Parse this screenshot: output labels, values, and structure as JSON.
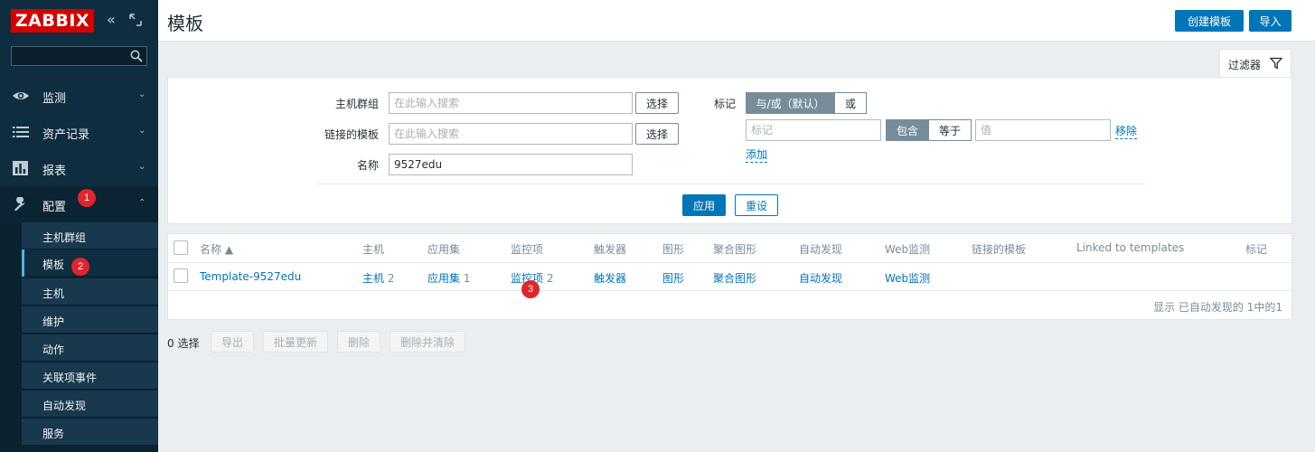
{
  "sidebar": {
    "logo": "ZABBIX",
    "menu": [
      {
        "label": "监测"
      },
      {
        "label": "资产记录"
      },
      {
        "label": "报表"
      },
      {
        "label": "配置"
      }
    ],
    "submenu": [
      "主机群组",
      "模板",
      "主机",
      "维护",
      "动作",
      "关联项事件",
      "自动发现",
      "服务"
    ],
    "badges": {
      "config": "1",
      "templates": "2",
      "items": "3"
    }
  },
  "header": {
    "title": "模板",
    "create_button": "创建模板",
    "import_button": "导入"
  },
  "filter": {
    "tab_label": "过滤器",
    "host_group_label": "主机群组",
    "host_group_placeholder": "在此输入搜索",
    "linked_templates_label": "链接的模板",
    "linked_templates_placeholder": "在此输入搜索",
    "name_label": "名称",
    "name_value": "9527edu",
    "select_button": "选择",
    "tags_label": "标记",
    "and_or_label": "与/或（默认）",
    "or_label": "或",
    "tag_placeholder": "标记",
    "contains_label": "包含",
    "equals_label": "等于",
    "value_placeholder": "值",
    "remove_label": "移除",
    "add_label": "添加",
    "apply_button": "应用",
    "reset_button": "重设"
  },
  "table": {
    "headers": [
      "名称 ▲",
      "主机",
      "应用集",
      "监控项",
      "触发器",
      "图形",
      "聚合图形",
      "自动发现",
      "Web监测",
      "链接的模板",
      "Linked to templates",
      "标记"
    ],
    "row": {
      "name": "Template-9527edu",
      "hosts": "主机",
      "hosts_count": "2",
      "applications": "应用集",
      "applications_count": "1",
      "items": "监控项",
      "items_count": "2",
      "triggers": "触发器",
      "graphs": "图形",
      "screens": "聚合图形",
      "discovery": "自动发现",
      "web": "Web监测"
    },
    "footer": "显示 已自动发现的 1中的1"
  },
  "actions": {
    "selected": "0 选择",
    "export": "导出",
    "mass_update": "批量更新",
    "delete": "删除",
    "delete_clear": "删除并清除"
  }
}
